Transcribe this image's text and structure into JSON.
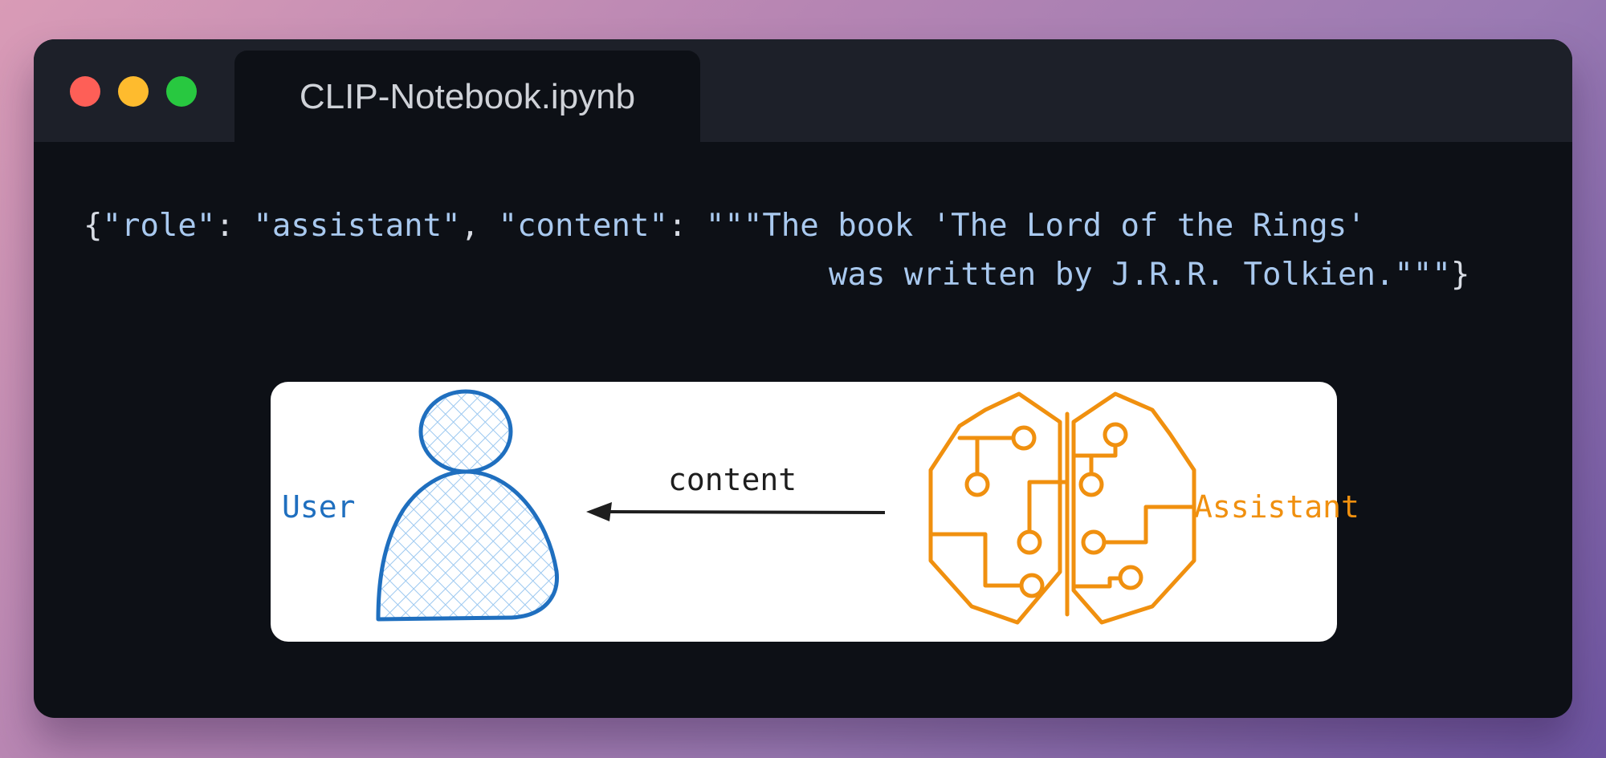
{
  "window": {
    "tab_title": "CLIP-Notebook.ipynb"
  },
  "code": {
    "open_brace": "{",
    "key_role": "\"role\"",
    "colon_1": ": ",
    "value_role": "\"assistant\"",
    "comma": ", ",
    "key_content": "\"content\"",
    "colon_2": ": ",
    "content_line1": "\"\"\"The book 'The Lord of the Rings'",
    "content_line2": "was written by J.R.R. Tolkien.\"\"\"",
    "close_brace": "}"
  },
  "diagram": {
    "user_label": "User",
    "assistant_label": "Assistant",
    "arrow_label": "content",
    "user_color": "#1f6fbf",
    "assistant_color": "#f0900f",
    "user_icon": "person-icon",
    "assistant_icon": "ai-brain-circuit-icon"
  }
}
